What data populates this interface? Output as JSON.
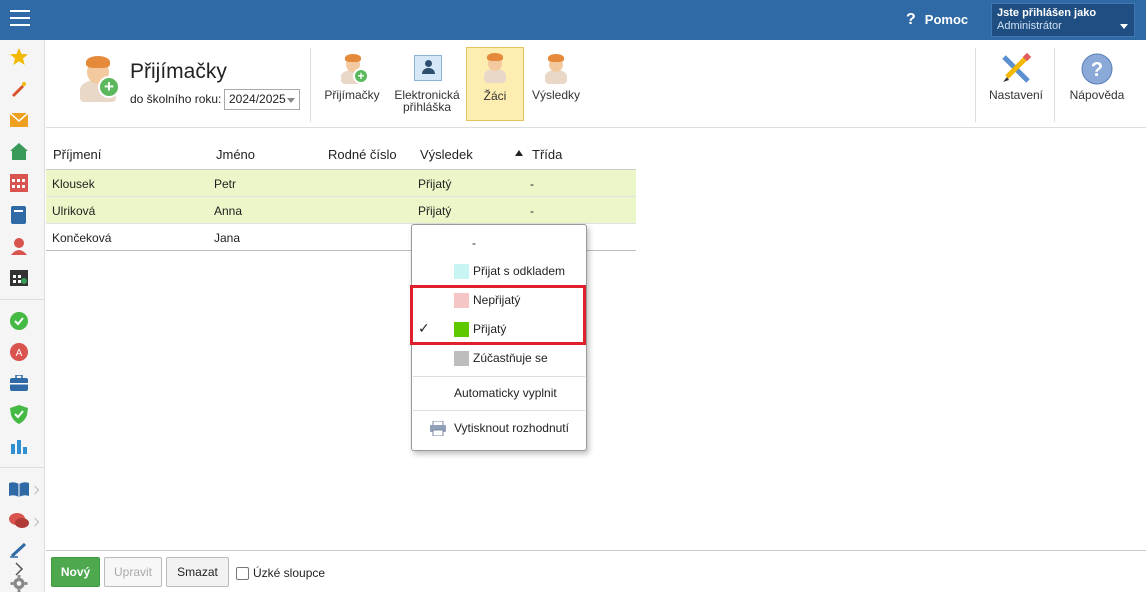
{
  "topbar": {
    "help_label": "Pomoc",
    "user_line1": "Jste přihlášen jako",
    "user_line2": "Administrátor"
  },
  "sidebar": {
    "items": [
      {
        "icon": "star-icon",
        "color": "#f2b900"
      },
      {
        "icon": "magic-wand-icon",
        "color": "#d9532c"
      },
      {
        "icon": "envelope-icon",
        "color": "#f0a020"
      },
      {
        "icon": "home-icon",
        "color": "#3a9a5a"
      },
      {
        "icon": "calendar-icon",
        "color": "#d9534f"
      },
      {
        "icon": "book-icon",
        "color": "#2f6aa6"
      },
      {
        "icon": "person-icon",
        "color": "#d9534f"
      },
      {
        "icon": "timetable-icon",
        "color": "#333333"
      },
      {
        "icon": "check-circle-icon",
        "color": "#44b944"
      },
      {
        "icon": "grade-icon",
        "color": "#d9534f"
      },
      {
        "icon": "briefcase-icon",
        "color": "#2f6aa6"
      },
      {
        "icon": "shield-icon",
        "color": "#44b944"
      },
      {
        "icon": "chart-icon",
        "color": "#2f8fd0"
      },
      {
        "icon": "open-book-icon",
        "color": "#2f6aa6"
      },
      {
        "icon": "chat-icon",
        "color": "#d9534f"
      },
      {
        "icon": "pen-icon",
        "color": "#2f6aa6"
      },
      {
        "icon": "gear-icon",
        "color": "#888888"
      }
    ]
  },
  "header": {
    "title": "Přijímačky",
    "year_label": "do školního roku:",
    "year_value": "2024/2025",
    "tools": [
      {
        "label": "Přijímačky"
      },
      {
        "label_line1": "Elektronická",
        "label_line2": "přihláška"
      },
      {
        "label": "Žáci"
      },
      {
        "label": "Výsledky"
      },
      {
        "label": "Nastavení"
      },
      {
        "label": "Nápověda"
      }
    ]
  },
  "grid": {
    "columns": [
      "Příjmení",
      "Jméno",
      "Rodné číslo",
      "Výsledek",
      "Třída"
    ],
    "rows": [
      {
        "prijmeni": "Klousek",
        "jmeno": "Petr",
        "rodne_cislo": "",
        "vysledek": "Přijatý",
        "trida": "-"
      },
      {
        "prijmeni": "Ulriková",
        "jmeno": "Anna",
        "rodne_cislo": "",
        "vysledek": "Přijatý",
        "trida": "-"
      },
      {
        "prijmeni": "Končeková",
        "jmeno": "Jana",
        "rodne_cislo": "",
        "vysledek": "",
        "trida": ""
      }
    ],
    "accepted_row_color": "#ebf7c8"
  },
  "dropdown": {
    "options": [
      {
        "label": "-",
        "color": null,
        "checked": false
      },
      {
        "label": "Přijat s odkladem",
        "color": "#c8f4f4",
        "checked": false
      },
      {
        "label": "Nepřijatý",
        "color": "#f6c6c6",
        "checked": false
      },
      {
        "label": "Přijatý",
        "color": "#5ec800",
        "checked": true
      },
      {
        "label": "Zúčastňuje se",
        "color": "#bdbdbd",
        "checked": false
      }
    ],
    "check_mark": "✓",
    "auto_fill": "Automaticky vyplnit",
    "print_decision": "Vytisknout rozhodnutí",
    "highlight_color": "#e0202a"
  },
  "footer": {
    "new_label": "Nový",
    "edit_label": "Upravit",
    "delete_label": "Smazat",
    "narrow_columns_label": "Úzké sloupce"
  }
}
